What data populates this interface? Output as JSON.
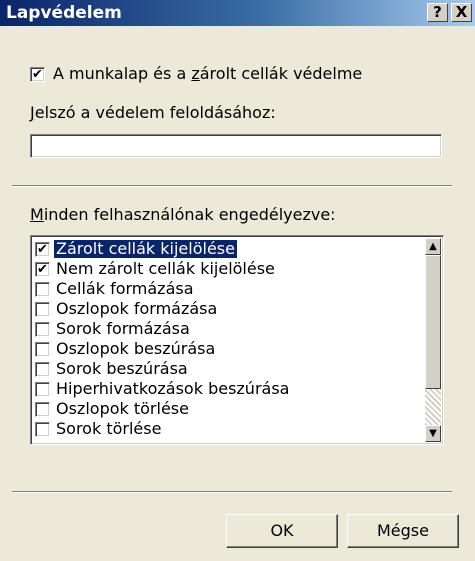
{
  "window": {
    "title": "Lapvédelem",
    "help_label": "?",
    "close_label": "X"
  },
  "protect": {
    "checked": "✔",
    "label_before": "A munkalap és a ",
    "label_key": "z",
    "label_after": "árolt cellák védelme"
  },
  "password": {
    "label_key": "J",
    "label_rest": "elszó a védelem feloldásához:",
    "value": ""
  },
  "allow": {
    "label_key": "M",
    "label_rest": "inden felhasználónak engedélyezve:",
    "items": [
      {
        "label": "Zárolt cellák kijelölése",
        "check": "✔"
      },
      {
        "label": "Nem zárolt cellák kijelölése",
        "check": "✔"
      },
      {
        "label": "Cellák formázása",
        "check": ""
      },
      {
        "label": "Oszlopok formázása",
        "check": ""
      },
      {
        "label": "Sorok formázása",
        "check": ""
      },
      {
        "label": "Oszlopok beszúrása",
        "check": ""
      },
      {
        "label": "Sorok beszúrása",
        "check": ""
      },
      {
        "label": "Hiperhivatkozások beszúrása",
        "check": ""
      },
      {
        "label": "Oszlopok törlése",
        "check": ""
      },
      {
        "label": "Sorok törlése",
        "check": ""
      }
    ],
    "scroll_up": "▲",
    "scroll_down": "▼"
  },
  "buttons": {
    "ok": "OK",
    "cancel": "Mégse"
  }
}
